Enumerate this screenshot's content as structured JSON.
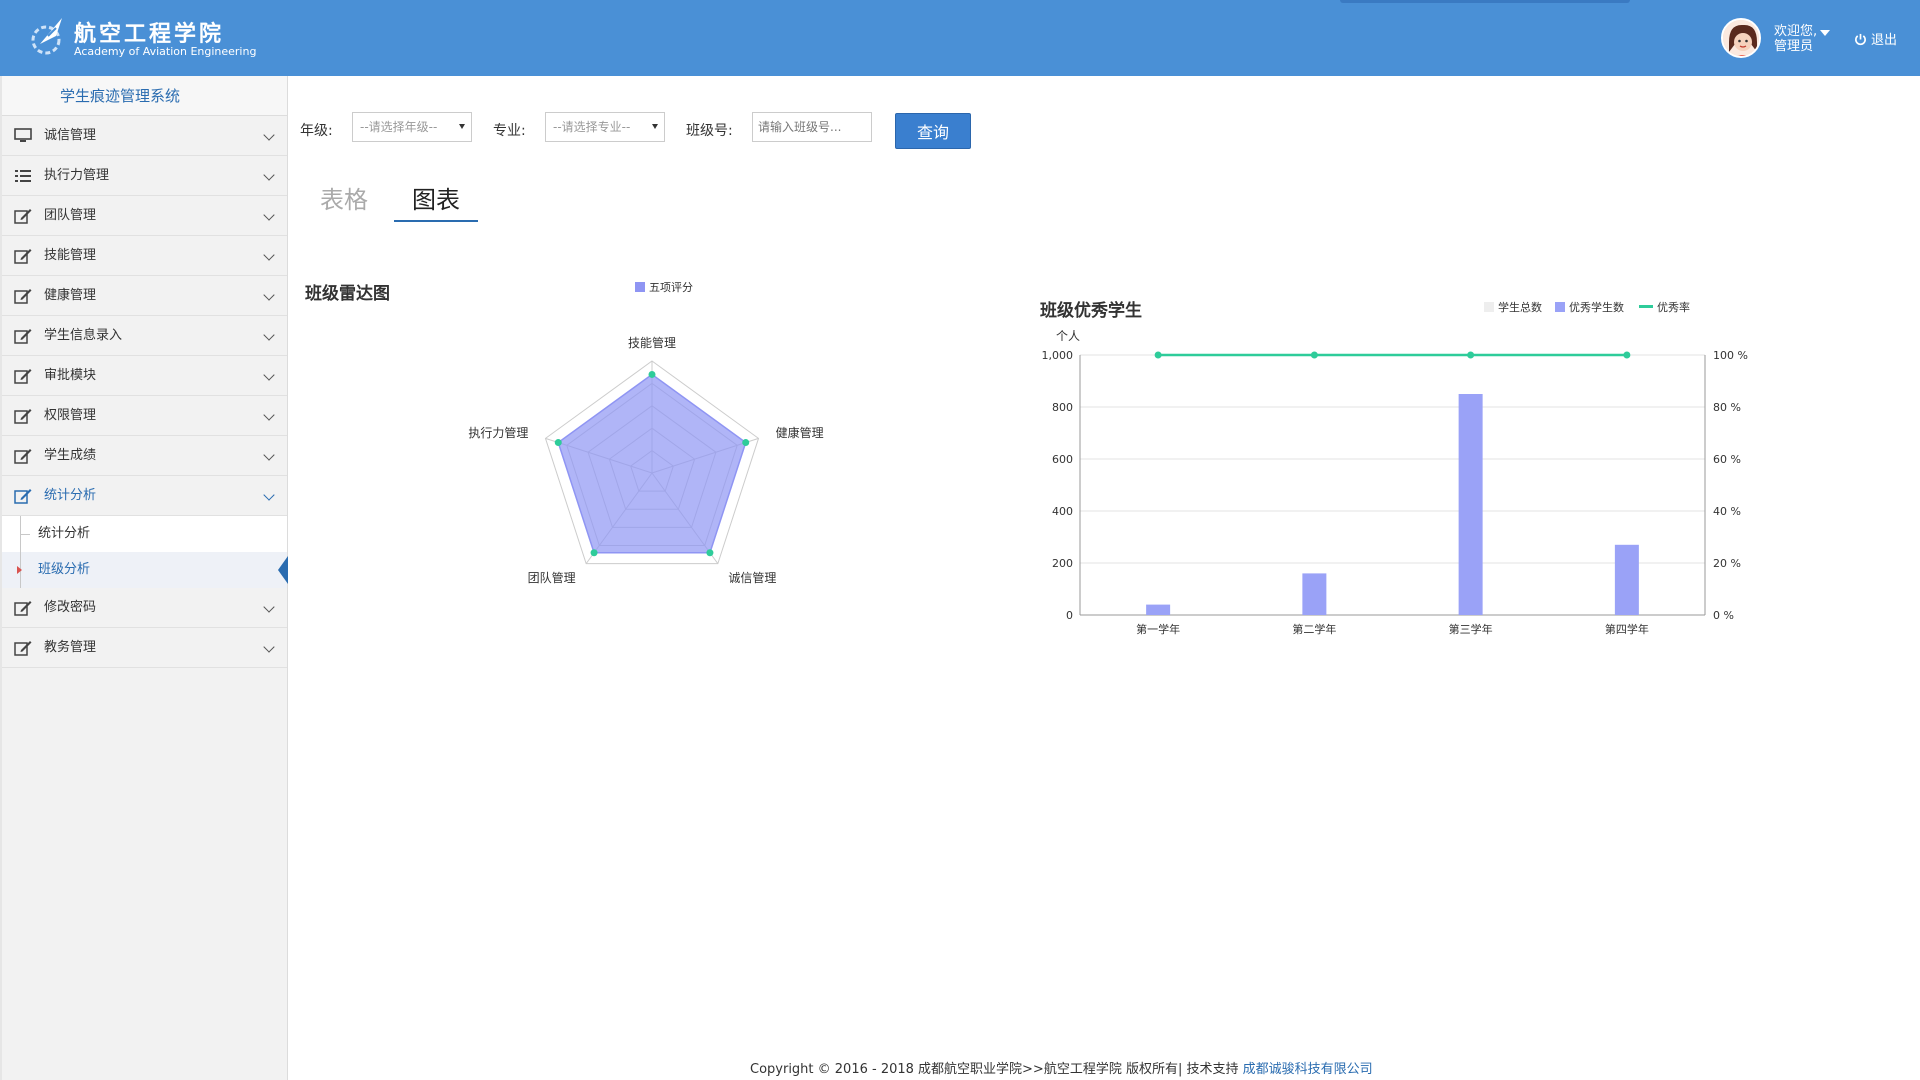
{
  "header": {
    "logo_cn": "航空工程学院",
    "logo_en": "Academy of Aviation Engineering",
    "welcome": "欢迎您,",
    "user": "管理员",
    "logout": "退出",
    "bg_color": "#4a90d6"
  },
  "sidebar": {
    "title": "学生痕迹管理系统",
    "items": [
      {
        "label": "诚信管理",
        "icon": "monitor-icon"
      },
      {
        "label": "执行力管理",
        "icon": "list-icon"
      },
      {
        "label": "团队管理",
        "icon": "edit-icon"
      },
      {
        "label": "技能管理",
        "icon": "edit-icon"
      },
      {
        "label": "健康管理",
        "icon": "edit-icon"
      },
      {
        "label": "学生信息录入",
        "icon": "edit-icon"
      },
      {
        "label": "审批模块",
        "icon": "edit-icon"
      },
      {
        "label": "权限管理",
        "icon": "edit-icon"
      },
      {
        "label": "学生成绩",
        "icon": "edit-icon"
      },
      {
        "label": "统计分析",
        "icon": "edit-icon"
      },
      {
        "label": "修改密码",
        "icon": "edit-icon"
      },
      {
        "label": "教务管理",
        "icon": "edit-icon"
      }
    ],
    "sub_items": [
      {
        "label": "统计分析"
      },
      {
        "label": "班级分析"
      }
    ]
  },
  "filter": {
    "grade_label": "年级:",
    "grade_value": "--请选择年级--",
    "major_label": "专业:",
    "major_value": "--请选择专业--",
    "class_label": "班级号:",
    "class_placeholder": "请输入班级号...",
    "query": "查询"
  },
  "tabs": {
    "table": "表格",
    "chart": "图表"
  },
  "chart_data": [
    {
      "type": "radar",
      "title": "班级雷达图",
      "legend": [
        "五项评分"
      ],
      "indicators": [
        "技能管理",
        "健康管理",
        "诚信管理",
        "团队管理",
        "执行力管理"
      ],
      "series": [
        {
          "name": "五项评分",
          "values": [
            88,
            88,
            88,
            88,
            88
          ],
          "max": 100
        }
      ],
      "color": "#8f95f3"
    },
    {
      "type": "bar",
      "title": "班级优秀学生",
      "legend": [
        "学生总数",
        "优秀学生数",
        "优秀率"
      ],
      "ylabel": "个人",
      "categories": [
        "第一学年",
        "第二学年",
        "第三学年",
        "第四学年"
      ],
      "series": [
        {
          "name": "学生总数",
          "values": [
            0,
            0,
            0,
            0
          ]
        },
        {
          "name": "优秀学生数",
          "values": [
            40,
            160,
            850,
            270
          ]
        },
        {
          "name": "优秀率",
          "values": [
            100,
            100,
            100,
            100
          ],
          "type": "line"
        }
      ],
      "ylim": [
        0,
        1000
      ],
      "y_ticks": [
        "0",
        "200",
        "400",
        "600",
        "800",
        "1,000"
      ],
      "y2lim": [
        0,
        100
      ],
      "y2_ticks": [
        "0 %",
        "20 %",
        "40 %",
        "60 %",
        "80 %",
        "100 %"
      ],
      "colors": {
        "total": "#eeeeee",
        "excellent": "#9aa2f7",
        "rate": "#2ecc9a"
      }
    }
  ],
  "footer": {
    "text": "Copyright © 2016 - 2018 成都航空职业学院>>航空工程学院 版权所有| 技术支持",
    "company": "成都诚骏科技有限公司"
  }
}
